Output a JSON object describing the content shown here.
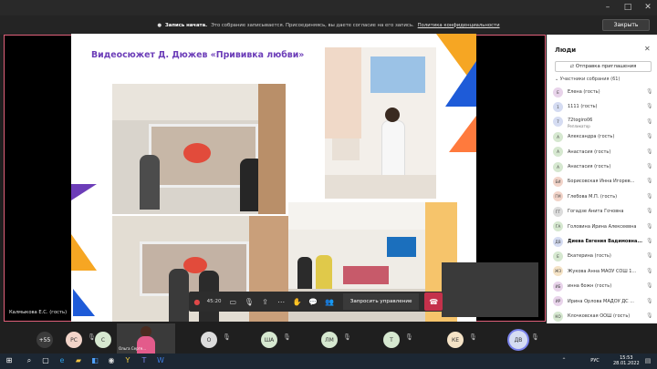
{
  "banner": {
    "title": "Запись начата.",
    "text": "Это собрание записывается. Присоединяясь, вы даете согласие на его запись.",
    "link": "Политика конфиденциальности",
    "close_label": "Закрыть"
  },
  "slide": {
    "title": "Видеосюжет Д. Дюжев «Прививка любви»"
  },
  "stage": {
    "presenter_label": "Калмыкова Е.С. (гость)"
  },
  "controls": {
    "timer": "45:20",
    "request_control": "Запросить управление"
  },
  "panel": {
    "title": "Люди",
    "invite_label": "Отправка приглашения",
    "section_header": "Участники собрания (61)",
    "participants": [
      {
        "initials": "Е",
        "name": "Елена (гость)",
        "color": "#e8d3ea"
      },
      {
        "initials": "1",
        "name": "1111 (гость)",
        "color": "#d5dcf2"
      },
      {
        "initials": "7",
        "name": "72togiro06",
        "role": "Репликатор",
        "color": "#d5dcf2"
      },
      {
        "initials": "А",
        "name": "Александра (гость)",
        "color": "#d6e8d0"
      },
      {
        "initials": "А",
        "name": "Анастасия (гость)",
        "color": "#d6e8d0"
      },
      {
        "initials": "А",
        "name": "Анастасия (гость)",
        "color": "#d6e8d0"
      },
      {
        "initials": "БИ",
        "name": "Борисовская Инна Игорев...",
        "color": "#f2d4c9"
      },
      {
        "initials": "ГМ",
        "name": "Глебова М.П. (гость)",
        "color": "#f2d4c9"
      },
      {
        "initials": "ГГ",
        "name": "Гогадзе Анита Гочовна",
        "color": "#dcdcdc"
      },
      {
        "initials": "ГА",
        "name": "Головина Ирина Алексеевна",
        "color": "#d6e8d0"
      },
      {
        "initials": "ДВ",
        "name": "Диева Евгения Вадимовна...",
        "color": "#d5dcf2",
        "bold": true
      },
      {
        "initials": "Е",
        "name": "Екатерина (гость)",
        "color": "#d6e8d0"
      },
      {
        "initials": "ЖЗ",
        "name": "Жукова Анна МАОУ СОШ 1...",
        "color": "#f5e3c6"
      },
      {
        "initials": "ИБ",
        "name": "инна божн (гость)",
        "color": "#e8d3ea"
      },
      {
        "initials": "ИР",
        "name": "Ирина Орлова МАДОУ ДС ...",
        "color": "#e8d3ea"
      },
      {
        "initials": "КО",
        "name": "Клочковская ООШ (гость)",
        "color": "#d6e8d0"
      }
    ]
  },
  "gallery": {
    "items": [
      {
        "label": "+55",
        "color": "#3b3b3b",
        "text_color": "#ffffff"
      },
      {
        "label": "РС",
        "color": "#f2d4c9",
        "text_color": "#333333"
      },
      {
        "label": "С",
        "color": "#d6e8d0",
        "text_color": "#333333"
      },
      {
        "label": "О",
        "color": "#dcdcdc",
        "text_color": "#333333"
      },
      {
        "label": "ША",
        "color": "#d6e8d0",
        "text_color": "#333333"
      },
      {
        "label": "ЛМ",
        "color": "#d6e8d0",
        "text_color": "#333333"
      },
      {
        "label": "Т",
        "color": "#d6e8d0",
        "text_color": "#333333"
      },
      {
        "label": "КЕ",
        "color": "#f5e3c6",
        "text_color": "#333333"
      },
      {
        "label": "ДВ",
        "color": "#d5dcf2",
        "text_color": "#333333"
      }
    ],
    "video_tile_name": "Ольга Серге..."
  },
  "taskbar": {
    "time": "15:53",
    "date": "28.01.2022",
    "lang": "РУС"
  }
}
